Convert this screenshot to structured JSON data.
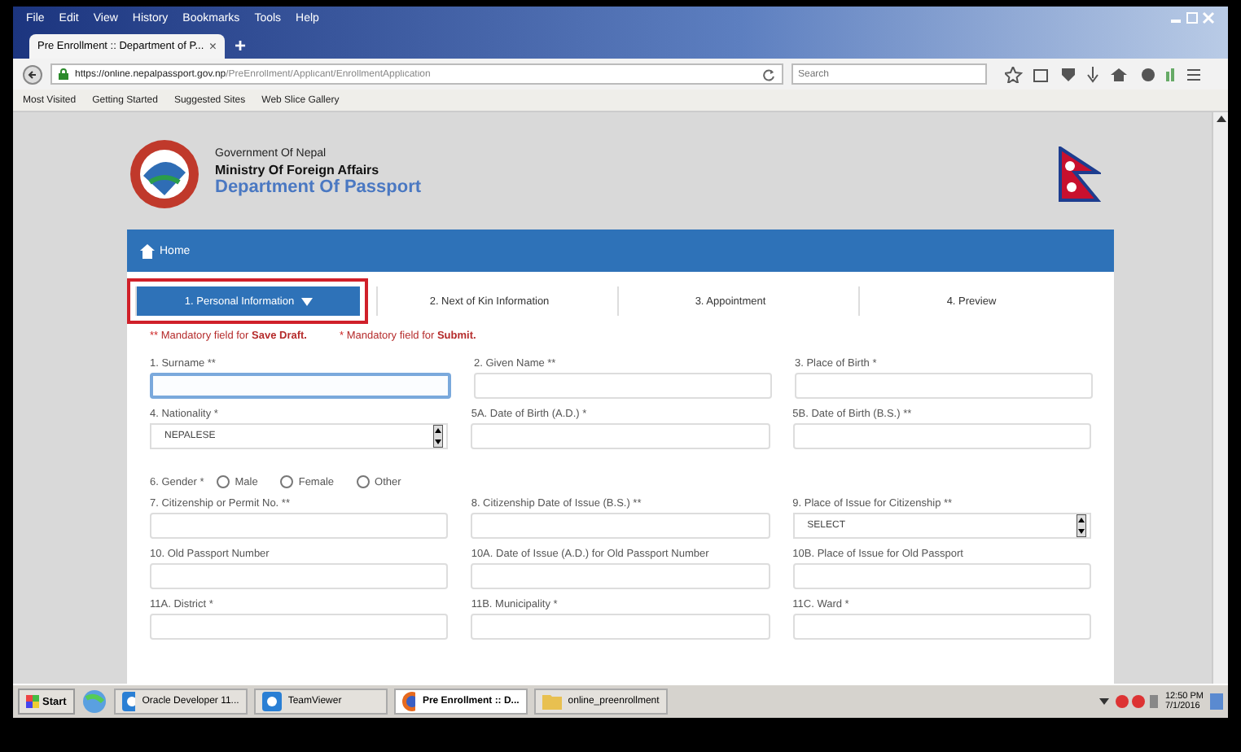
{
  "browser": {
    "menu": [
      "File",
      "Edit",
      "View",
      "History",
      "Bookmarks",
      "Tools",
      "Help"
    ],
    "tab": {
      "title": "Pre Enrollment :: Department of P...",
      "close": "×"
    },
    "new_tab": "+",
    "url": {
      "host": "https://online.nepalpassport.gov.np",
      "path": "/PreEnrollment/Applicant/EnrollmentApplication"
    },
    "search": {
      "placeholder": "Search"
    },
    "bookmarks": [
      "Most Visited",
      "Getting Started",
      "Suggested Sites",
      "Web Slice Gallery"
    ]
  },
  "header": {
    "line1": "Government Of Nepal",
    "line2": "Ministry Of Foreign Affairs",
    "line3": "Department Of Passport"
  },
  "nav": {
    "home": "Home"
  },
  "steps": [
    {
      "label": "1. Personal Information",
      "selected": true
    },
    {
      "label": "2. Next of Kin Information",
      "selected": false
    },
    {
      "label": "3. Appointment",
      "selected": false
    },
    {
      "label": "4. Preview",
      "selected": false
    }
  ],
  "notes": [
    {
      "marks": "**",
      "text": "Mandatory field for **Save Draft.**"
    },
    {
      "marks": "*",
      "text": "Mandatory field for **Submit.**"
    }
  ],
  "form": [
    {
      "kind": "fields",
      "fields": [
        {
          "label": "1. Surname **",
          "kind": "text",
          "focused": true
        },
        {
          "label": "2. Given Name **",
          "kind": "text",
          "focused": false
        },
        {
          "label": "3. Place of Birth *",
          "kind": "text",
          "focused": false
        }
      ]
    },
    {
      "kind": "fields",
      "fields": [
        {
          "label": "4. Nationality *",
          "kind": "select",
          "value": "NEPALESE"
        },
        {
          "label": "5A. Date of Birth (A.D.) *",
          "kind": "text",
          "focused": false
        },
        {
          "label": "5B. Date of Birth (B.S.) **",
          "kind": "text",
          "focused": false
        }
      ]
    },
    {
      "kind": "radios",
      "label": "6. Gender *",
      "options": [
        {
          "label": "Male",
          "selected": false
        },
        {
          "label": "Female",
          "selected": false
        },
        {
          "label": "Other",
          "selected": false
        }
      ]
    },
    {
      "kind": "fields",
      "fields": [
        {
          "label": "7. Citizenship or Permit No. **",
          "kind": "text",
          "focused": false
        },
        {
          "label": "8. Citizenship Date of Issue (B.S.) **",
          "kind": "text",
          "focused": false
        },
        {
          "label": "9. Place of Issue for Citizenship **",
          "kind": "select",
          "value": "SELECT"
        }
      ]
    },
    {
      "kind": "fields",
      "fields": [
        {
          "label": "10. Old Passport Number",
          "kind": "text",
          "focused": false
        },
        {
          "label": "10A. Date of Issue (A.D.) for Old Passport Number",
          "kind": "text",
          "focused": false
        },
        {
          "label": "10B. Place of Issue for Old Passport",
          "kind": "text",
          "focused": false
        }
      ]
    },
    {
      "kind": "fields",
      "fields": [
        {
          "label": "11A. District *",
          "kind": "text",
          "focused": false
        },
        {
          "label": "11B. Municipality *",
          "kind": "text",
          "focused": false
        },
        {
          "label": "11C. Ward *",
          "kind": "text",
          "focused": false
        }
      ]
    }
  ],
  "taskbar": {
    "start": "Start",
    "items": [
      {
        "label": "Oracle Developer 11...",
        "kind": "app",
        "selected": false
      },
      {
        "label": "TeamViewer",
        "kind": "app",
        "selected": false
      },
      {
        "label": "Pre Enrollment :: D...",
        "kind": "browser",
        "selected": true
      },
      {
        "label": "online_preenrollment",
        "kind": "folder",
        "selected": false
      }
    ],
    "time": "12:50 PM",
    "date": "7/1/2016"
  }
}
